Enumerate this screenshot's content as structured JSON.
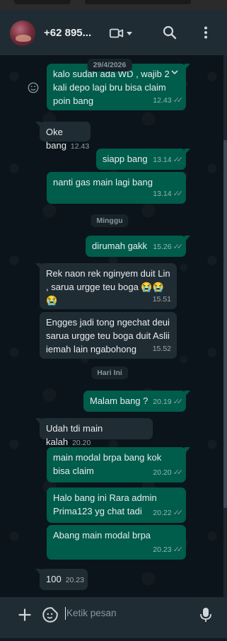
{
  "header": {
    "contact_name": "+62 895...",
    "icons": {
      "avatar": "avatar",
      "video": "video-call-icon",
      "search": "search-icon",
      "menu": "more-vert-icon"
    }
  },
  "chat": {
    "date_top": "29/4/2026",
    "messages": [
      {
        "dir": "out",
        "text": "kalo sudah ada WD , wajib 2 kali depo lagi bru bisa claim poin bang",
        "time": "12.43",
        "ticks": "✓✓"
      },
      {
        "dir": "in",
        "text": "Oke bang",
        "time": "12.43"
      },
      {
        "dir": "out",
        "text": "siapp bang",
        "time": "13.14",
        "ticks": "✓✓"
      },
      {
        "dir": "out",
        "text": "nanti gas main lagi bang",
        "time": "13.14",
        "ticks": "✓✓"
      },
      {
        "dir": "out",
        "text": "dirumah gakk",
        "time": "15.26",
        "ticks": "✓✓"
      },
      {
        "dir": "in",
        "text": "Rek naon rek nginyem duit Lin , sarua urgge teu boga 😭😭😭",
        "time": "15.51"
      },
      {
        "dir": "in",
        "text": "Engges jadi tong ngechat deui sarua urgge teu boga duit Aslii iemah lain ngabohong",
        "time": "15.52"
      },
      {
        "dir": "out",
        "text": "Malam bang ?",
        "time": "20.19",
        "ticks": "✓✓"
      },
      {
        "dir": "in",
        "text": "Udah tdi main kalah",
        "time": "20.20"
      },
      {
        "dir": "out",
        "text": "main modal brpa bang kok bisa claim",
        "time": "20.20",
        "ticks": "✓✓"
      },
      {
        "dir": "out",
        "text": "Halo bang ini Rara admin Prima123 yg chat tadi",
        "time": "20.22",
        "ticks": "✓✓"
      },
      {
        "dir": "out",
        "text": "Abang main modal brpa",
        "time": "20.23",
        "ticks": "✓✓"
      },
      {
        "dir": "in",
        "text": "100",
        "time": "20.23"
      }
    ],
    "date_chips": [
      "Minggu",
      "Hari Ini"
    ]
  },
  "composer": {
    "placeholder": "Ketik pesan",
    "icons": {
      "attach": "plus-icon",
      "sticker": "sticker-icon",
      "mic": "microphone-icon"
    }
  },
  "colors": {
    "header_bg": "#202c33",
    "chat_bg": "#0b141a",
    "outgoing_bubble": "#005c4b",
    "incoming_bubble": "#202c33",
    "muted_text": "#8696a0"
  }
}
